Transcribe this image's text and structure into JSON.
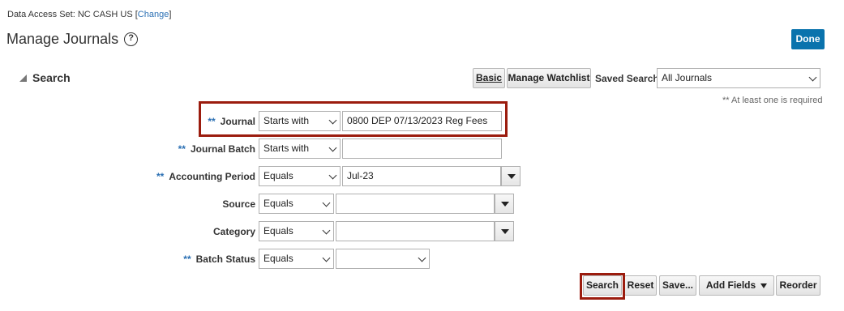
{
  "header": {
    "data_access_label": "Data Access Set:",
    "data_access_value": "NC CASH US",
    "change_link": "Change",
    "title": "Manage Journals",
    "help_symbol": "?",
    "done_label": "Done"
  },
  "search": {
    "heading": "Search",
    "basic_label": "Basic",
    "manage_watchlist_label": "Manage Watchlist",
    "saved_search_label": "Saved Search",
    "saved_search_value": "All Journals",
    "required_note": "** At least one is required"
  },
  "fields": {
    "journal": {
      "stars": "**",
      "label": "Journal",
      "operator": "Starts with",
      "value": "0800 DEP 07/13/2023 Reg Fees"
    },
    "journal_batch": {
      "stars": "**",
      "label": "Journal Batch",
      "operator": "Starts with",
      "value": ""
    },
    "accounting_period": {
      "stars": "**",
      "label": "Accounting Period",
      "operator": "Equals",
      "value": "Jul-23"
    },
    "source": {
      "label": "Source",
      "operator": "Equals",
      "value": ""
    },
    "category": {
      "label": "Category",
      "operator": "Equals",
      "value": ""
    },
    "batch_status": {
      "stars": "**",
      "label": "Batch Status",
      "operator": "Equals",
      "value": ""
    }
  },
  "actions": {
    "search_label": "Search",
    "reset_label": "Reset",
    "save_label": "Save...",
    "add_fields_label": "Add Fields",
    "reorder_label": "Reorder"
  },
  "colors": {
    "accent": "#0a73ad",
    "highlight": "#9b1c0e",
    "required_star": "#2a6fb3"
  }
}
